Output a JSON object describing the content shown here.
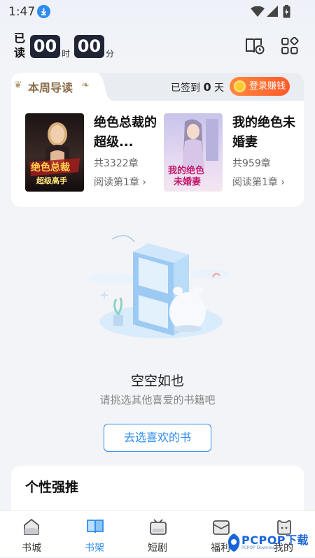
{
  "status_bar": {
    "time": "1:47"
  },
  "header": {
    "read_label": "已读",
    "hours": "00",
    "hours_unit": "时",
    "minutes": "00",
    "minutes_unit": "分"
  },
  "weekly": {
    "title": "本周导读",
    "signed_prefix": "已签到",
    "signed_days": "0",
    "signed_suffix": "天",
    "login_earn_label": "登录赚钱",
    "books": [
      {
        "title": "绝色总裁的超级...",
        "chapters": "共3322章",
        "read_label": "阅读第1章 ›"
      },
      {
        "title": "我的绝色未婚妻",
        "chapters": "共959章",
        "read_label": "阅读第1章 ›"
      }
    ]
  },
  "empty_state": {
    "title": "空空如也",
    "subtitle": "请挑选其他喜爱的书籍吧",
    "button_label": "去选喜欢的书"
  },
  "recommend": {
    "title": "个性强推"
  },
  "bottom_nav": {
    "active_index": 1,
    "items": [
      {
        "label": "书城",
        "icon": "bookstore-icon"
      },
      {
        "label": "书架",
        "icon": "bookshelf-icon"
      },
      {
        "label": "短剧",
        "icon": "short-drama-icon"
      },
      {
        "label": "福利",
        "icon": "welfare-icon"
      },
      {
        "label": "我的",
        "icon": "profile-icon"
      }
    ]
  },
  "watermark": {
    "text": "PCPOP下载",
    "sub": "PCPOP Download"
  },
  "colors": {
    "accent": "#2d8cf0",
    "timer_bg": "#1f2535",
    "login_button": "#ff6a2e",
    "weekly_title": "#8a6d4a"
  }
}
